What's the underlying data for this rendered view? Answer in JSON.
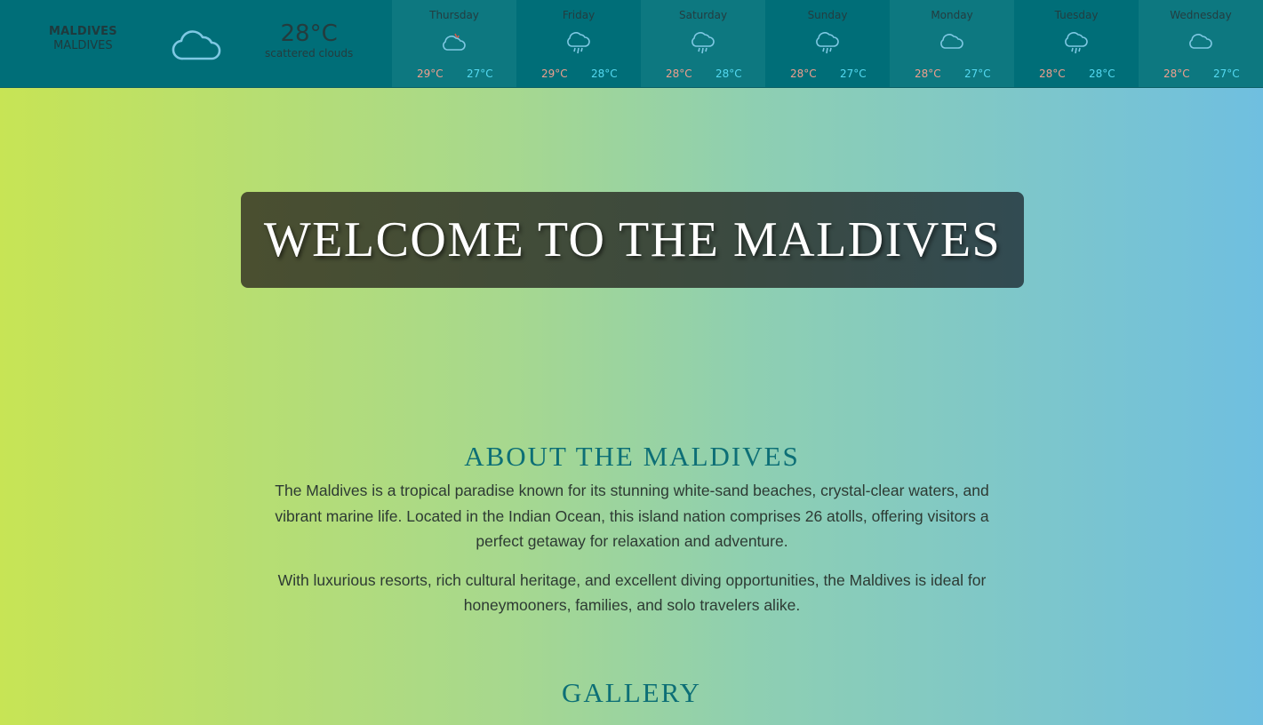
{
  "weather": {
    "location": {
      "city": "MALDIVES",
      "country": "MALDIVES"
    },
    "current": {
      "icon": "cloud-icon",
      "temperature": "28°C",
      "description": "scattered clouds"
    },
    "forecast": [
      {
        "day": "Thursday",
        "icon": "cloud-sun-rain-icon",
        "high": "29°C",
        "low": "27°C"
      },
      {
        "day": "Friday",
        "icon": "cloud-rain-icon",
        "high": "29°C",
        "low": "28°C"
      },
      {
        "day": "Saturday",
        "icon": "cloud-rain-icon",
        "high": "28°C",
        "low": "28°C"
      },
      {
        "day": "Sunday",
        "icon": "cloud-rain-icon",
        "high": "28°C",
        "low": "27°C"
      },
      {
        "day": "Monday",
        "icon": "cloud-icon",
        "high": "28°C",
        "low": "27°C"
      },
      {
        "day": "Tuesday",
        "icon": "cloud-rain-icon",
        "high": "28°C",
        "low": "28°C"
      },
      {
        "day": "Wednesday",
        "icon": "cloud-icon",
        "high": "28°C",
        "low": "27°C"
      }
    ],
    "colors": {
      "bar": "#006e78",
      "high": "#f09f8e",
      "low": "#55d9f1",
      "icon": "#7ec8e3"
    }
  },
  "hero": {
    "title": "WELCOME TO THE MALDIVES"
  },
  "about": {
    "heading": "ABOUT THE MALDIVES",
    "paragraphs": [
      "The Maldives is a tropical paradise known for its stunning white-sand beaches, crystal-clear waters, and vibrant marine life. Located in the Indian Ocean, this island nation comprises 26 atolls, offering visitors a perfect getaway for relaxation and adventure.",
      "With luxurious resorts, rich cultural heritage, and excellent diving opportunities, the Maldives is ideal for honeymooners, families, and solo travelers alike."
    ]
  },
  "gallery": {
    "heading": "GALLERY"
  }
}
